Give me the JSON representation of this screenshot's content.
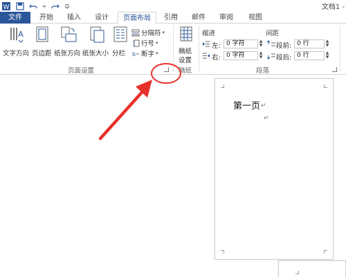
{
  "title_bar": {
    "doc_title": "文档1 -"
  },
  "tabs": [
    {
      "label": "文件"
    },
    {
      "label": "开始"
    },
    {
      "label": "插入"
    },
    {
      "label": "设计"
    },
    {
      "label": "页面布局"
    },
    {
      "label": "引用"
    },
    {
      "label": "邮件"
    },
    {
      "label": "审阅"
    },
    {
      "label": "视图"
    }
  ],
  "ribbon": {
    "page_setup": {
      "text_direction": "文字方向",
      "margins": "页边距",
      "orientation": "纸张方向",
      "size": "纸张大小",
      "columns": "分栏",
      "breaks": "分隔符",
      "line_numbers": "行号",
      "hyphenation": "断字",
      "group_label": "页面设置"
    },
    "manuscript": {
      "button_label_line1": "稿纸",
      "button_label_line2": "设置",
      "group_label": "稿纸"
    },
    "paragraph": {
      "indent_header": "缩进",
      "spacing_header": "间距",
      "left_label": "左:",
      "left_value": "0 字符",
      "right_label": "右:",
      "right_value": "0 字符",
      "before_label": "段前:",
      "before_value": "0 行",
      "after_label": "段后:",
      "after_value": "0 行",
      "group_label": "段落"
    }
  },
  "document": {
    "page1_text": "第一页",
    "para_mark": "↵"
  },
  "colors": {
    "file_tab": "#2b579a",
    "accent": "#2b579a",
    "annotation": "#e8302a"
  }
}
